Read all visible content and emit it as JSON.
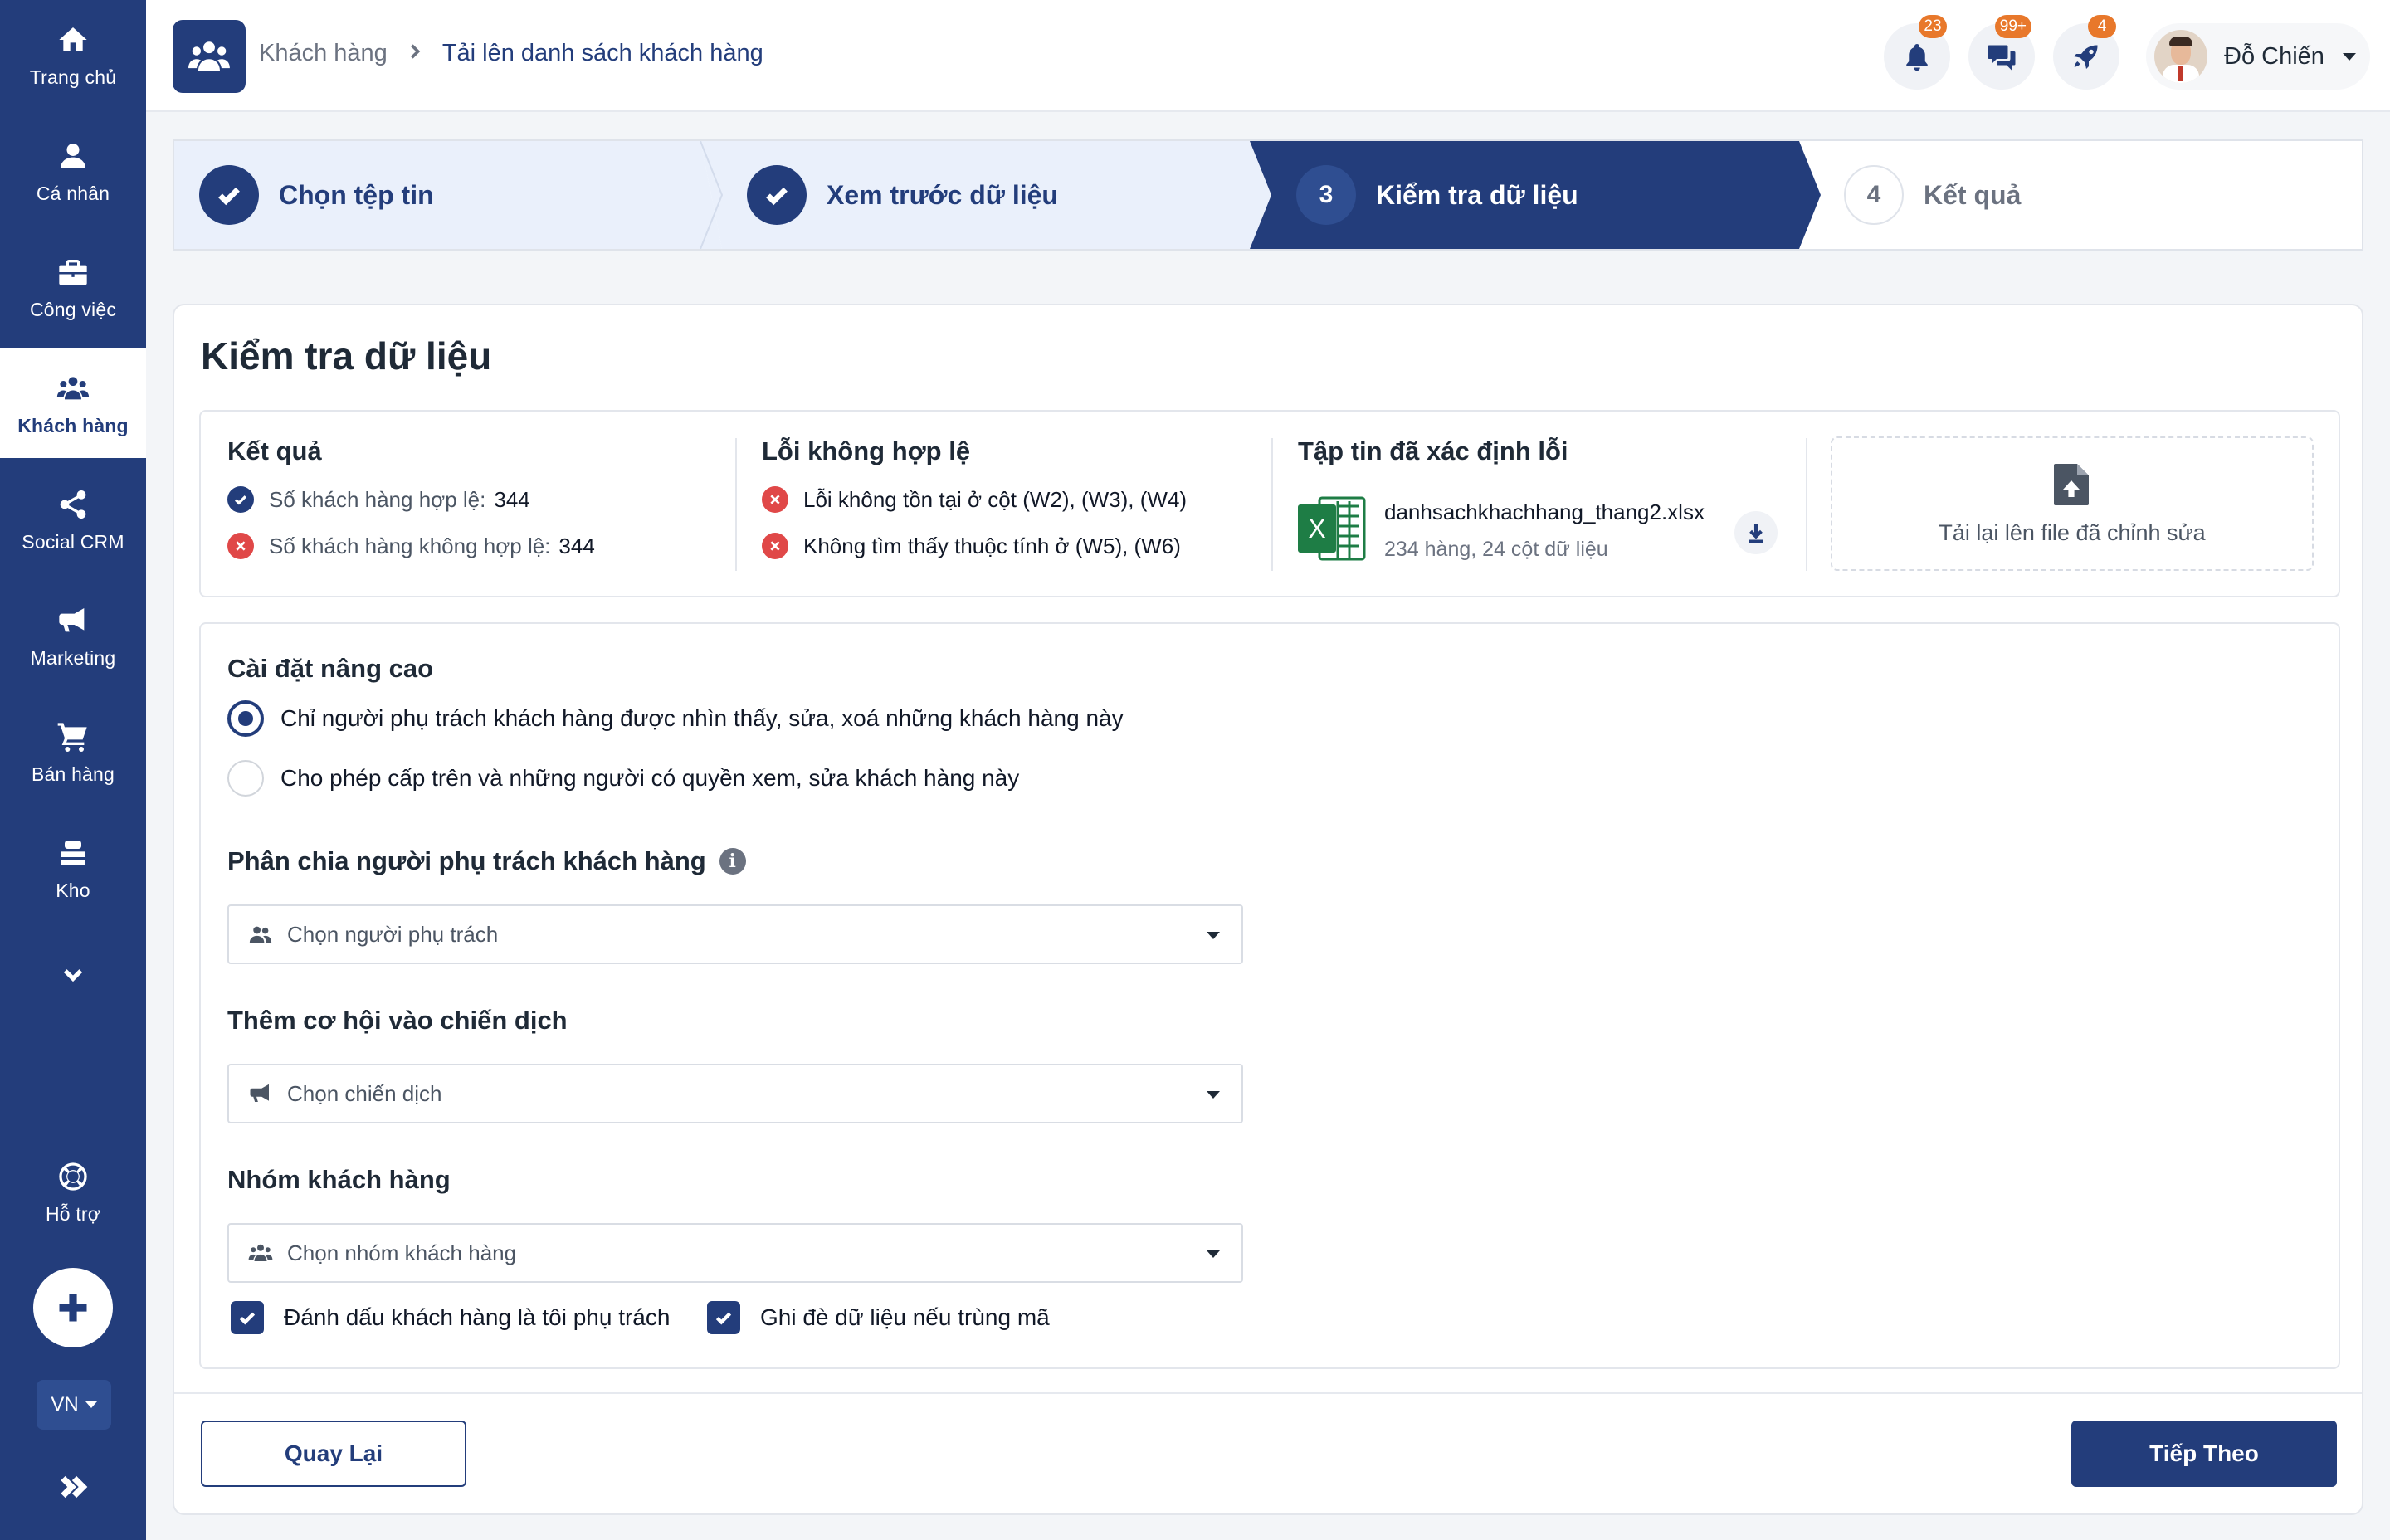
{
  "sidebar": {
    "items": [
      {
        "label": "Trang chủ",
        "icon": "home-icon"
      },
      {
        "label": "Cá nhân",
        "icon": "user-icon"
      },
      {
        "label": "Công việc",
        "icon": "briefcase-icon"
      },
      {
        "label": "Khách hàng",
        "icon": "customers-icon",
        "active": true
      },
      {
        "label": "Social CRM",
        "icon": "share-icon"
      },
      {
        "label": "Marketing",
        "icon": "megaphone-icon"
      },
      {
        "label": "Bán hàng",
        "icon": "cart-icon"
      },
      {
        "label": "Kho",
        "icon": "warehouse-icon"
      }
    ],
    "support_label": "Hỗ trợ",
    "language": "VN"
  },
  "header": {
    "breadcrumb_parent": "Khách hàng",
    "breadcrumb_current": "Tải lên danh sách khách hàng",
    "notifications_badge": "23",
    "messages_badge": "99+",
    "activity_badge": "4",
    "user_name": "Đỗ Chiến"
  },
  "stepper": {
    "steps": [
      {
        "number": "1",
        "label": "Chọn tệp tin",
        "state": "done"
      },
      {
        "number": "2",
        "label": "Xem trước dữ liệu",
        "state": "done"
      },
      {
        "number": "3",
        "label": "Kiểm tra dữ liệu",
        "state": "active"
      },
      {
        "number": "4",
        "label": "Kết quả",
        "state": "todo"
      }
    ]
  },
  "main": {
    "title": "Kiểm tra dữ liệu",
    "result": {
      "title": "Kết quả",
      "valid_label": "Số khách hàng hợp lệ:",
      "valid_count": "344",
      "invalid_label": "Số khách hàng không hợp lệ:",
      "invalid_count": "344"
    },
    "errors": {
      "title": "Lỗi không hợp lệ",
      "items": [
        "Lỗi không tồn tại ở cột (W2), (W3), (W4)",
        "Không tìm thấy thuộc tính ở (W5), (W6)"
      ]
    },
    "error_file": {
      "title": "Tập tin đã xác định lỗi",
      "file_name": "danhsachkhachhang_thang2.xlsx",
      "meta": "234 hàng, 24 cột dữ liệu"
    },
    "reupload_label": "Tải lại lên file đã chỉnh sửa",
    "advanced": {
      "title": "Cài đặt nâng cao",
      "option_1": "Chỉ người phụ trách khách hàng được nhìn thấy, sửa, xoá những khách hàng này",
      "option_2": "Cho phép cấp trên và những người có quyền xem, sửa khách hàng này",
      "selected_option": 1
    },
    "assign": {
      "title": "Phân chia người phụ trách khách hàng",
      "placeholder": "Chọn người phụ trách"
    },
    "campaign": {
      "title": "Thêm cơ hội vào chiến dịch",
      "placeholder": "Chọn chiến dịch"
    },
    "group": {
      "title": "Nhóm khách hàng",
      "placeholder": "Chọn nhóm khách hàng"
    },
    "check_mark_owner": "Đánh dấu khách hàng là tôi phụ trách",
    "check_overwrite": "Ghi đè dữ liệu nếu trùng mã",
    "back_label": "Quay Lại",
    "next_label": "Tiếp Theo"
  },
  "colors": {
    "primary": "#233d7b",
    "badge": "#e8782b",
    "error": "#e04848",
    "excel": "#1e7d45"
  }
}
